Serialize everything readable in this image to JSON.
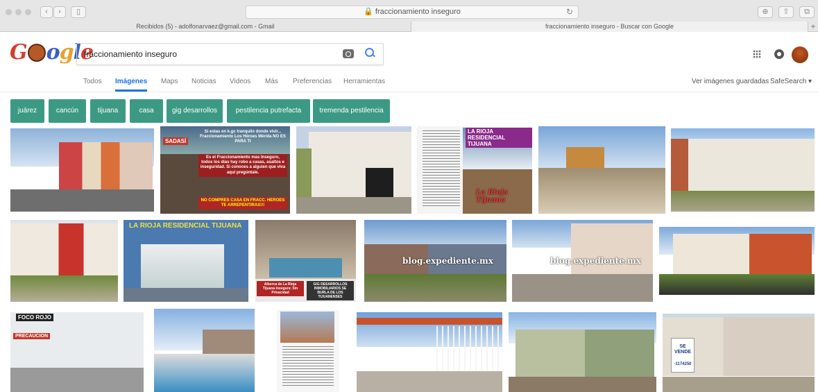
{
  "browser": {
    "url": "fraccionamiento inseguro",
    "tabs": [
      {
        "label": "Recibidos (5) - adolfonarvaez@gmail.com - Gmail",
        "active": false
      },
      {
        "label": "fraccionamiento inseguro - Buscar con Google",
        "active": true
      }
    ]
  },
  "search": {
    "query": "fraccionamiento inseguro"
  },
  "nav": {
    "items": [
      "Todos",
      "Imágenes",
      "Maps",
      "Noticias",
      "Videos",
      "Más",
      "Preferencias",
      "Herramientas"
    ],
    "active": "Imágenes",
    "saved_images": "Ver imágenes guardadas",
    "safesearch": "SafeSearch ▾"
  },
  "chips": [
    "juárez",
    "cancún",
    "tijuana",
    "casa",
    "gig desarrollos",
    "pestilencia putrefacta",
    "tremenda pestilencia"
  ],
  "image_text": {
    "sadasi": "SADASÍ",
    "poster_lines": "Si estas en k.gc tranquilo donde vivir... Fraccionamiento Los Héroes Mérida NO ES PARA TI",
    "poster_body": "Es el Fraccionamiento mas Inseguro, todos los días hay robo a casas, asaltos e inseguridad. Si conoces a alguien que viva aquí pregúntale.",
    "poster_footer": "NO COMPRES CASA EN FRACC. HEROES TE ARREPENTIRAS!!!",
    "rioja": "La Rioja Tijuana",
    "rioja_banner": "LA RIOJA RESIDENCIAL TIJUANA",
    "rioja_caption_1": "Alberca de La Rioja Tijuana insegura: Sin Privacidad",
    "rioja_caption_2": "GIG DESARROLLOS INMOBILIARIOS SE BURLA DE LOS TIJUANENSES",
    "blog_1": "blog.expediente.mx",
    "blog_2": "blog.expediente.mx",
    "foco_rojo": "FOCO ROJO",
    "precaucion": "PRECAUCION",
    "se_vende": "SE VENDE",
    "phone": "-1174250"
  },
  "colors": {
    "chip": "#3c9a84",
    "accent": "#1a73e8"
  }
}
